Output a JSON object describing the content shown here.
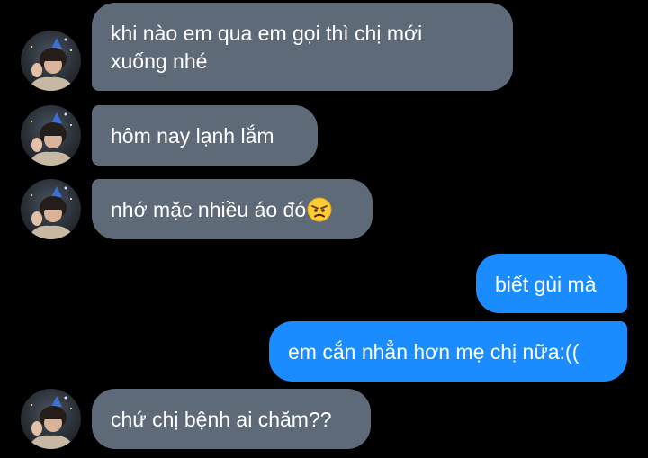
{
  "colors": {
    "background": "#000000",
    "incoming_bubble": "#5f6a78",
    "outgoing_bubble": "#1a8cff",
    "text": "#ffffff"
  },
  "messages": [
    {
      "side": "incoming",
      "lines": [
        "khi nào em qua em gọi thì chị mới",
        "xuống nhé"
      ],
      "has_avatar": true
    },
    {
      "side": "incoming",
      "text": "hôm nay lạnh lắm",
      "has_avatar": true
    },
    {
      "side": "incoming",
      "text": "nhớ mặc nhiều áo đó",
      "emoji": "angry-face-emoji",
      "has_avatar": true
    },
    {
      "side": "outgoing",
      "text": "biết gùi mà"
    },
    {
      "side": "outgoing",
      "text": "em cắn nhẳn hơn mẹ chị nữa:(("
    },
    {
      "side": "incoming",
      "text": "chứ chị bệnh ai chăm??",
      "has_avatar": true
    }
  ]
}
